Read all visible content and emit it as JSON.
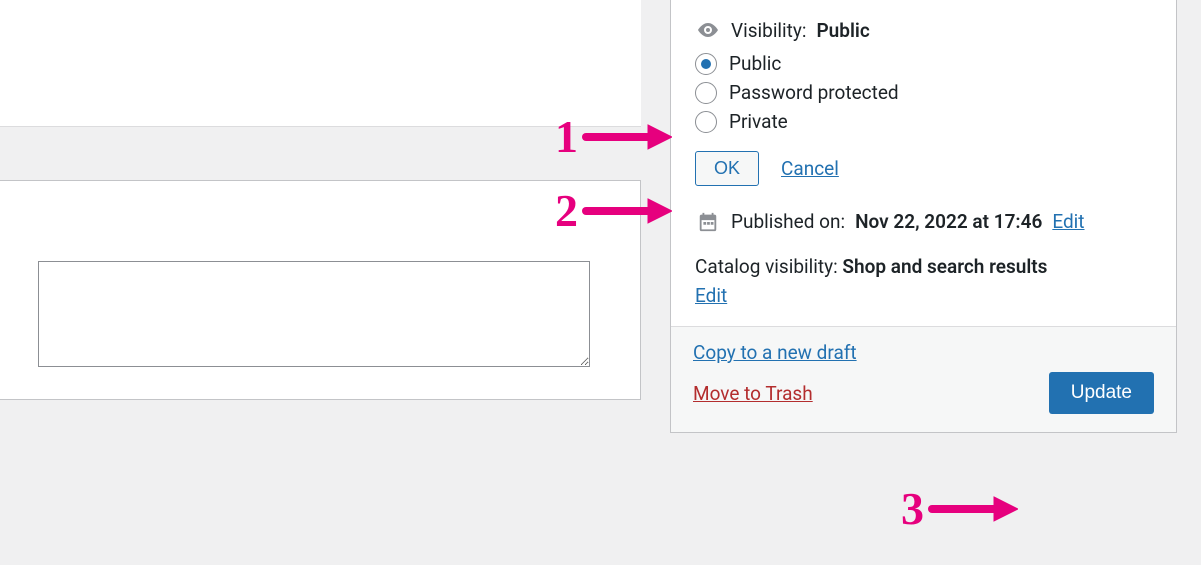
{
  "visibility": {
    "label": "Visibility:",
    "value": "Public",
    "options": [
      {
        "label": "Public",
        "checked": true
      },
      {
        "label": "Password protected",
        "checked": false
      },
      {
        "label": "Private",
        "checked": false
      }
    ],
    "ok": "OK",
    "cancel": "Cancel"
  },
  "published": {
    "label": "Published on:",
    "value": "Nov 22, 2022 at 17:46",
    "edit": "Edit"
  },
  "catalog": {
    "label": "Catalog visibility:",
    "value": "Shop and search results",
    "edit": "Edit"
  },
  "footer": {
    "copy": "Copy to a new draft",
    "trash": "Move to Trash",
    "update": "Update"
  },
  "annotations": {
    "one": "1",
    "two": "2",
    "three": "3"
  }
}
